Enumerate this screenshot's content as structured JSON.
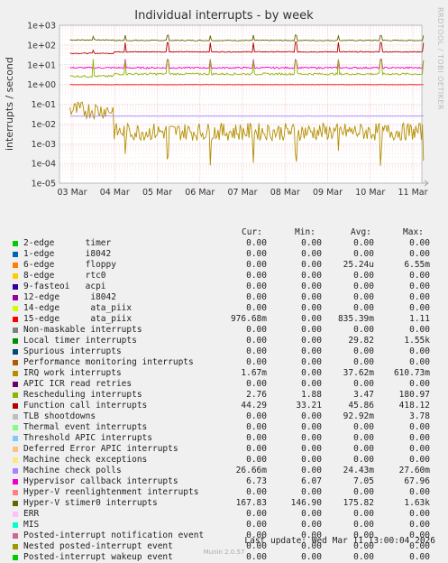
{
  "title": "Individual interrupts - by week",
  "side_credit": "RRDTOOL / TOBI OETIKER",
  "footer_credit": "Munin 2.0.57",
  "last_update": "Last update: Wed Mar 11 13:00:04 2026",
  "legend_headers": {
    "cur": "Cur:",
    "min": "Min:",
    "avg": "Avg:",
    "max": "Max:"
  },
  "chart_data": {
    "type": "line",
    "title": "Individual interrupts - by week",
    "ylabel": "interrupts / second",
    "yscale": "log",
    "ylim": [
      1e-05,
      1000
    ],
    "y_ticks": [
      "1e-05",
      "1e-04",
      "1e-03",
      "1e-02",
      "1e-01",
      "1e+00",
      "1e+01",
      "1e+02",
      "1e+03"
    ],
    "x_ticks": [
      "03 Mar",
      "04 Mar",
      "05 Mar",
      "06 Mar",
      "07 Mar",
      "08 Mar",
      "09 Mar",
      "10 Mar",
      "11 Mar"
    ],
    "grid": true,
    "series": [
      {
        "name": "2-edge      timer",
        "color": "#00cc00",
        "cur": "0.00",
        "min": "0.00",
        "avg": "0.00",
        "max": "0.00"
      },
      {
        "name": "1-edge      i8042",
        "color": "#0066b3",
        "cur": "0.00",
        "min": "0.00",
        "avg": "0.00",
        "max": "0.00"
      },
      {
        "name": "6-edge      floppy",
        "color": "#ff8000",
        "cur": "0.00",
        "min": "0.00",
        "avg": "25.24u",
        "max": "6.55m"
      },
      {
        "name": "8-edge      rtc0",
        "color": "#ffcc00",
        "cur": "0.00",
        "min": "0.00",
        "avg": "0.00",
        "max": "0.00"
      },
      {
        "name": "9-fasteoi   acpi",
        "color": "#330099",
        "cur": "0.00",
        "min": "0.00",
        "avg": "0.00",
        "max": "0.00"
      },
      {
        "name": "12-edge      i8042",
        "color": "#990099",
        "cur": "0.00",
        "min": "0.00",
        "avg": "0.00",
        "max": "0.00"
      },
      {
        "name": "14-edge      ata_piix",
        "color": "#ccff00",
        "cur": "0.00",
        "min": "0.00",
        "avg": "0.00",
        "max": "0.00"
      },
      {
        "name": "15-edge      ata_piix",
        "color": "#ff0000",
        "cur": "976.68m",
        "min": "0.00",
        "avg": "835.39m",
        "max": "1.11"
      },
      {
        "name": "Non-maskable interrupts",
        "color": "#808080",
        "cur": "0.00",
        "min": "0.00",
        "avg": "0.00",
        "max": "0.00"
      },
      {
        "name": "Local timer interrupts",
        "color": "#008f00",
        "cur": "0.00",
        "min": "0.00",
        "avg": "29.82",
        "max": "1.55k"
      },
      {
        "name": "Spurious interrupts",
        "color": "#00487d",
        "cur": "0.00",
        "min": "0.00",
        "avg": "0.00",
        "max": "0.00"
      },
      {
        "name": "Performance monitoring interrupts",
        "color": "#b35a00",
        "cur": "0.00",
        "min": "0.00",
        "avg": "0.00",
        "max": "0.00"
      },
      {
        "name": "IRQ work interrupts",
        "color": "#b38f00",
        "cur": "1.67m",
        "min": "0.00",
        "avg": "37.62m",
        "max": "610.73m"
      },
      {
        "name": "APIC ICR read retries",
        "color": "#6b006b",
        "cur": "0.00",
        "min": "0.00",
        "avg": "0.00",
        "max": "0.00"
      },
      {
        "name": "Rescheduling interrupts",
        "color": "#8fb300",
        "cur": "2.76",
        "min": "1.88",
        "avg": "3.47",
        "max": "180.97"
      },
      {
        "name": "Function call interrupts",
        "color": "#b30000",
        "cur": "44.29",
        "min": "33.21",
        "avg": "45.86",
        "max": "418.12"
      },
      {
        "name": "TLB shootdowns",
        "color": "#bebebe",
        "cur": "0.00",
        "min": "0.00",
        "avg": "92.92m",
        "max": "3.78"
      },
      {
        "name": "Thermal event interrupts",
        "color": "#80ff80",
        "cur": "0.00",
        "min": "0.00",
        "avg": "0.00",
        "max": "0.00"
      },
      {
        "name": "Threshold APIC interrupts",
        "color": "#80c9ff",
        "cur": "0.00",
        "min": "0.00",
        "avg": "0.00",
        "max": "0.00"
      },
      {
        "name": "Deferred Error APIC interrupts",
        "color": "#ffc080",
        "cur": "0.00",
        "min": "0.00",
        "avg": "0.00",
        "max": "0.00"
      },
      {
        "name": "Machine check exceptions",
        "color": "#ffe680",
        "cur": "0.00",
        "min": "0.00",
        "avg": "0.00",
        "max": "0.00"
      },
      {
        "name": "Machine check polls",
        "color": "#aa80ff",
        "cur": "26.66m",
        "min": "0.00",
        "avg": "24.43m",
        "max": "27.60m"
      },
      {
        "name": "Hypervisor callback interrupts",
        "color": "#ee00cc",
        "cur": "6.73",
        "min": "6.07",
        "avg": "7.05",
        "max": "67.96"
      },
      {
        "name": "Hyper-V reenlightenment interrupts",
        "color": "#ff8080",
        "cur": "0.00",
        "min": "0.00",
        "avg": "0.00",
        "max": "0.00"
      },
      {
        "name": "Hyper-V stimer0 interrupts",
        "color": "#666600",
        "cur": "167.83",
        "min": "146.90",
        "avg": "175.82",
        "max": "1.63k"
      },
      {
        "name": "ERR",
        "color": "#ffbfff",
        "cur": "0.00",
        "min": "0.00",
        "avg": "0.00",
        "max": "0.00"
      },
      {
        "name": "MIS",
        "color": "#00ffcc",
        "cur": "0.00",
        "min": "0.00",
        "avg": "0.00",
        "max": "0.00"
      },
      {
        "name": "Posted-interrupt notification event",
        "color": "#cc6699",
        "cur": "0.00",
        "min": "0.00",
        "avg": "0.00",
        "max": "0.00"
      },
      {
        "name": "Nested posted-interrupt event",
        "color": "#999900",
        "cur": "0.00",
        "min": "0.00",
        "avg": "0.00",
        "max": "0.00"
      },
      {
        "name": "Posted-interrupt wakeup event",
        "color": "#00cc00",
        "cur": "0.00",
        "min": "0.00",
        "avg": "0.00",
        "max": "0.00"
      }
    ]
  }
}
